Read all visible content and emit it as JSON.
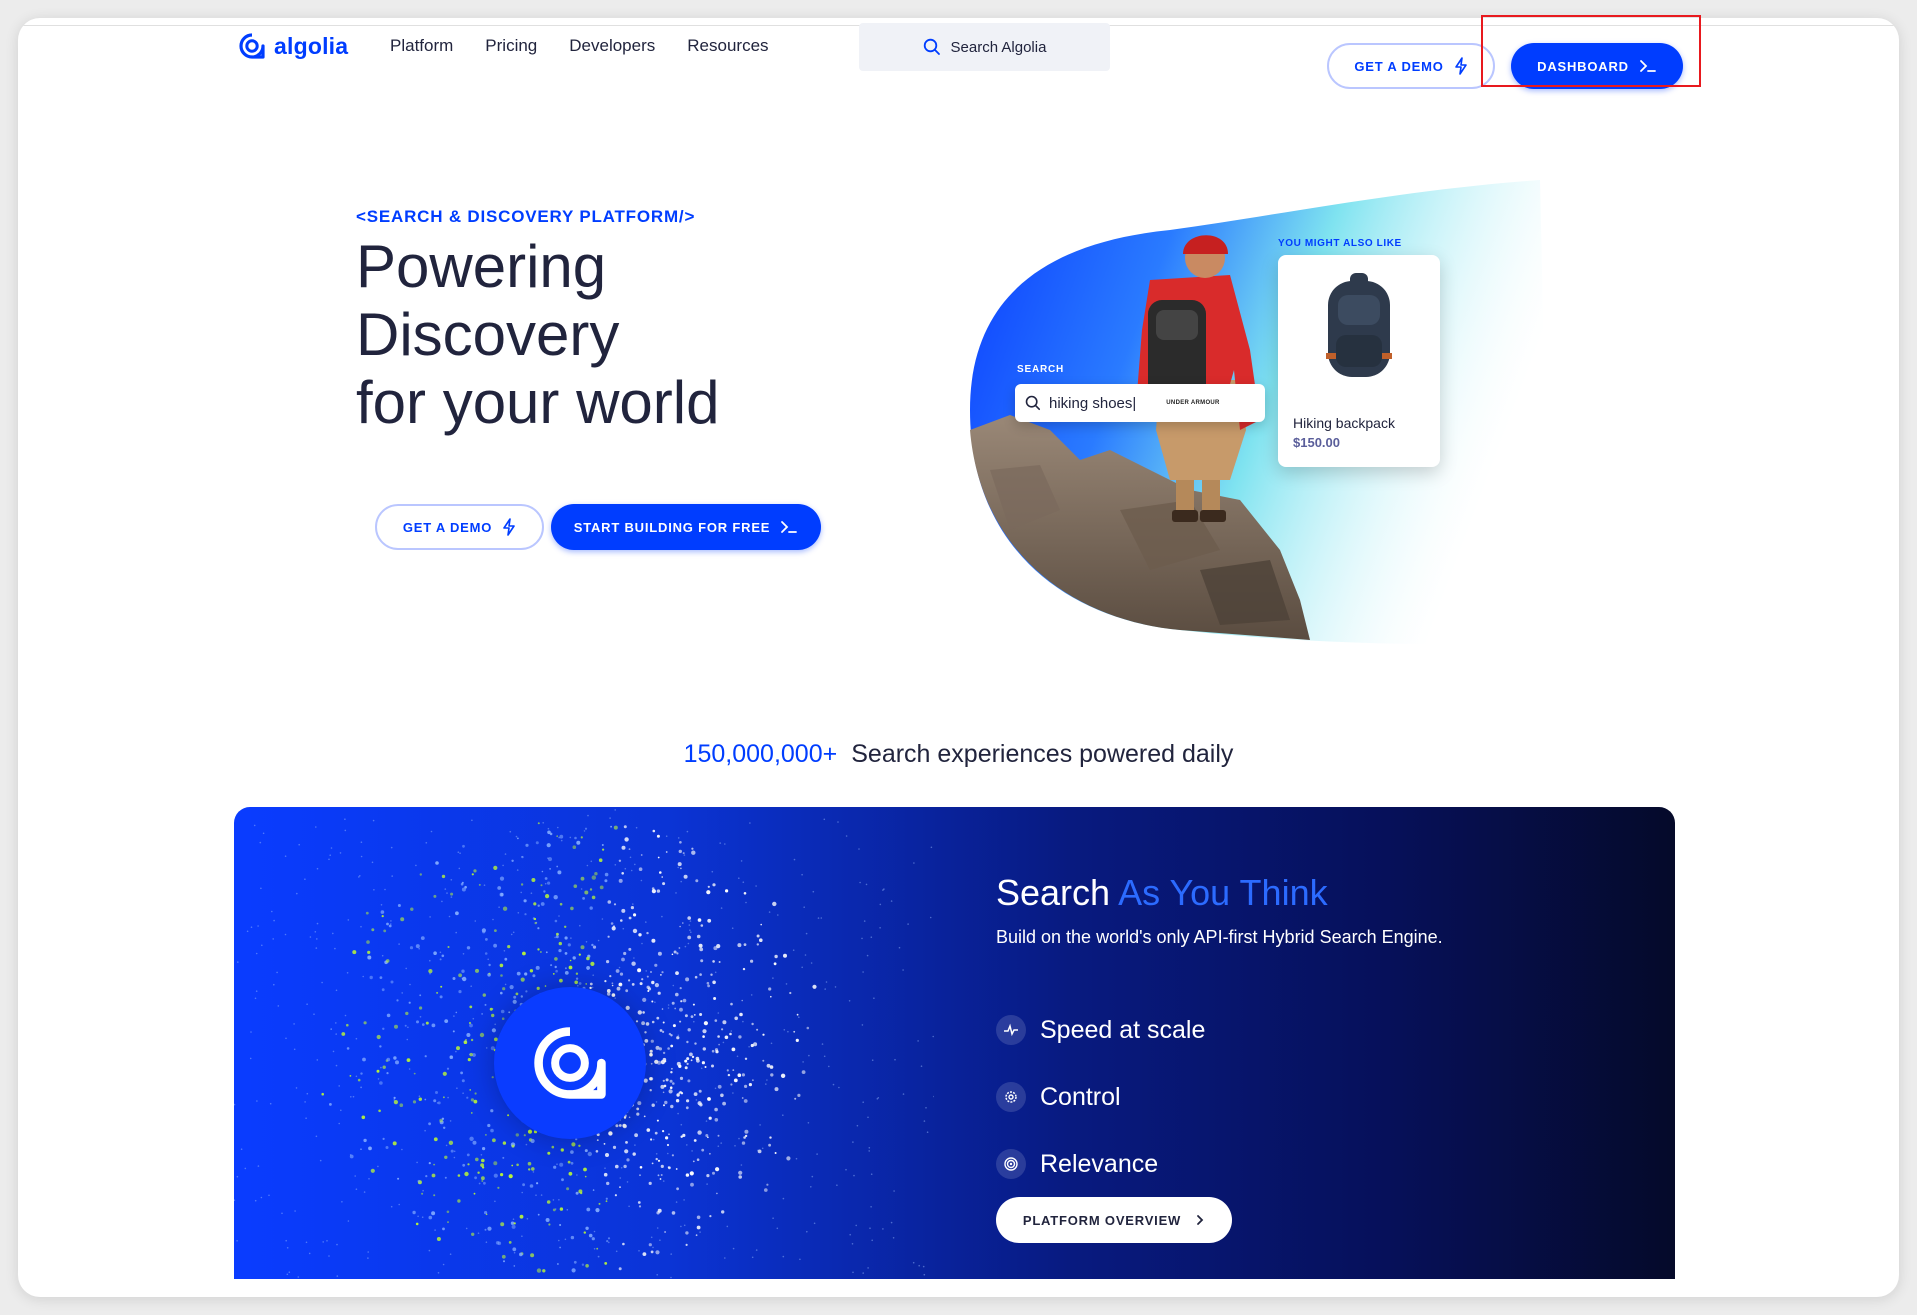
{
  "nav": {
    "logo_text": "algolia",
    "links": [
      "Platform",
      "Pricing",
      "Developers",
      "Resources"
    ],
    "search_placeholder": "Search Algolia",
    "get_demo_label": "GET A DEMO",
    "dashboard_label": "DASHBOARD"
  },
  "hero": {
    "eyebrow": "<SEARCH & DISCOVERY PLATFORM/>",
    "title_lines": [
      "Powering",
      "Discovery",
      "for your world"
    ],
    "get_demo_label": "GET A DEMO",
    "start_label": "START BUILDING FOR FREE",
    "visual": {
      "search_label": "SEARCH",
      "search_value": "hiking shoes|",
      "brand_text": "UNDER ARMOUR",
      "ymal_label": "YOU MIGHT ALSO LIKE",
      "product_name": "Hiking backpack",
      "product_price": "$150.00"
    }
  },
  "stats": {
    "number": "150,000,000+",
    "text": "Search experiences powered daily"
  },
  "platform": {
    "title_plain": "Search",
    "title_accent": "As You Think",
    "subtitle": "Build on the world's only API-first Hybrid Search Engine.",
    "features": [
      {
        "label": "Speed at scale",
        "icon": "pulse-icon"
      },
      {
        "label": "Control",
        "icon": "gear-icon"
      },
      {
        "label": "Relevance",
        "icon": "target-icon"
      }
    ],
    "button_label": "PLATFORM OVERVIEW"
  },
  "colors": {
    "brand": "#003dff",
    "text": "#21243d",
    "highlight": "#e8191e"
  }
}
